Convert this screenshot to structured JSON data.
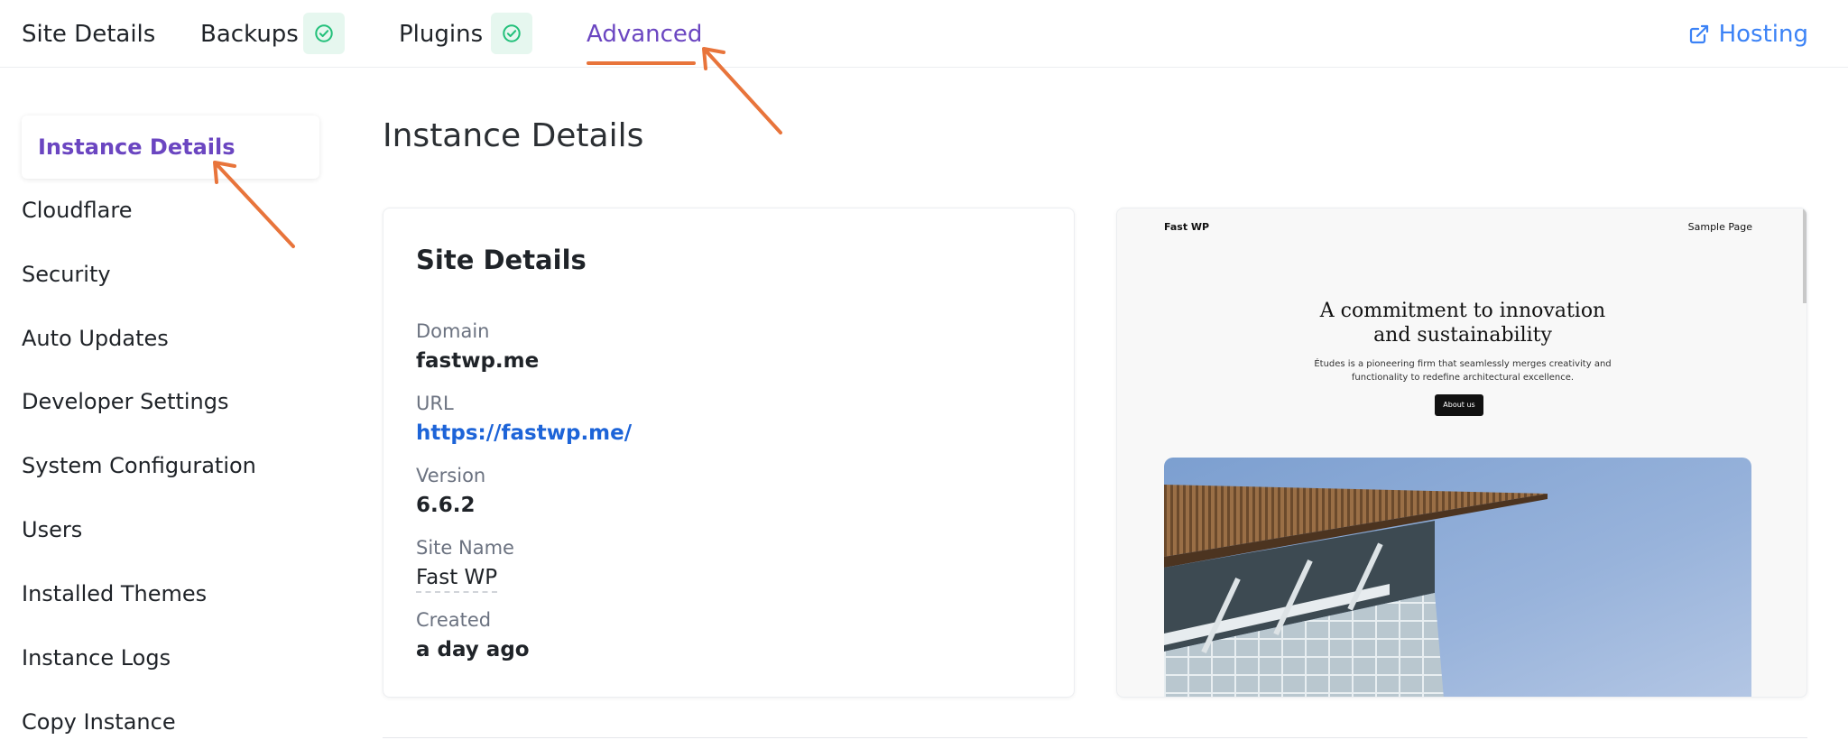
{
  "tabs": [
    {
      "label": "Site Details",
      "active": false,
      "status": ""
    },
    {
      "label": "Backups",
      "active": false,
      "status": "ok"
    },
    {
      "label": "Plugins",
      "active": false,
      "status": "ok"
    },
    {
      "label": "Advanced",
      "active": true,
      "status": ""
    }
  ],
  "hosting": {
    "label": "Hosting",
    "icon": "external-link-icon"
  },
  "sidebar": {
    "items": [
      {
        "label": "Instance Details",
        "active": true
      },
      {
        "label": "Cloudflare"
      },
      {
        "label": "Security"
      },
      {
        "label": "Auto Updates"
      },
      {
        "label": "Developer Settings"
      },
      {
        "label": "System Configuration"
      },
      {
        "label": "Users"
      },
      {
        "label": "Installed Themes"
      },
      {
        "label": "Instance Logs"
      },
      {
        "label": "Copy Instance"
      }
    ]
  },
  "main": {
    "title": "Instance Details",
    "card": {
      "title": "Site Details",
      "fields": [
        {
          "label": "Domain",
          "value": "fastwp.me"
        },
        {
          "label": "URL",
          "value": "https://fastwp.me/"
        },
        {
          "label": "Version",
          "value": "6.6.2"
        },
        {
          "label": "Site Name",
          "value": "Fast WP"
        },
        {
          "label": "Created",
          "value": "a day ago"
        }
      ]
    },
    "preview": {
      "brand": "Fast WP",
      "nav": "Sample Page",
      "headline_line1": "A commitment to innovation",
      "headline_line2": "and sustainability",
      "sub_line1": "Études is a pioneering firm that seamlessly merges creativity and",
      "sub_line2": "functionality to redefine architectural excellence.",
      "button": "About us"
    }
  },
  "colors": {
    "accent": "#6b46c1",
    "link": "#1d64d8",
    "annotation_arrow": "#e8743b",
    "success": "#22c07a"
  }
}
